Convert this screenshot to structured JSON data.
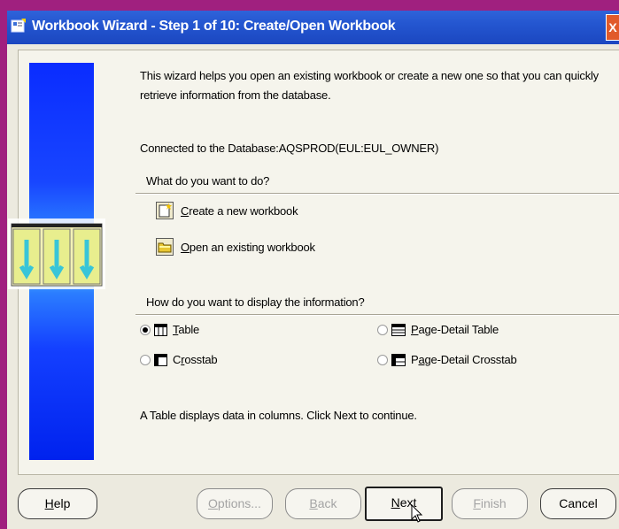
{
  "window": {
    "title": "Workbook Wizard - Step 1 of 10: Create/Open Workbook",
    "close_glyph": "X"
  },
  "intro": {
    "line1": "This wizard helps you open an existing workbook or create a new one so that you can quickly",
    "line2": "retrieve information from the database."
  },
  "connection": "Connected to the Database:AQSPROD(EUL:EUL_OWNER)",
  "action_section": {
    "heading": "What do you want to do?",
    "options": [
      {
        "label": "Create a new workbook",
        "mnemonic": "C",
        "icon": "new-workbook-icon"
      },
      {
        "label": "Open an existing workbook",
        "mnemonic": "O",
        "icon": "open-folder-icon"
      }
    ]
  },
  "display_section": {
    "heading": "How do you want to display the information?",
    "options": [
      {
        "label": "Table",
        "mnemonic": "T",
        "selected": true,
        "icon": "table-icon"
      },
      {
        "label": "Page-Detail Table",
        "mnemonic": "P",
        "selected": false,
        "icon": "page-detail-table-icon"
      },
      {
        "label": "Crosstab",
        "mnemonic": "r",
        "selected": false,
        "icon": "crosstab-icon"
      },
      {
        "label": "Page-Detail Crosstab",
        "mnemonic": "a",
        "selected": false,
        "icon": "page-detail-crosstab-icon"
      }
    ]
  },
  "hint": "A Table displays data in columns. Click Next to continue.",
  "buttons": {
    "help": "Help",
    "options": "Options...",
    "back": "Back",
    "next": "Next",
    "finish": "Finish",
    "cancel": "Cancel"
  },
  "colors": {
    "title_bar": "#2456d0",
    "banner": "#1846ff",
    "dialog_bg": "#eceadf"
  }
}
